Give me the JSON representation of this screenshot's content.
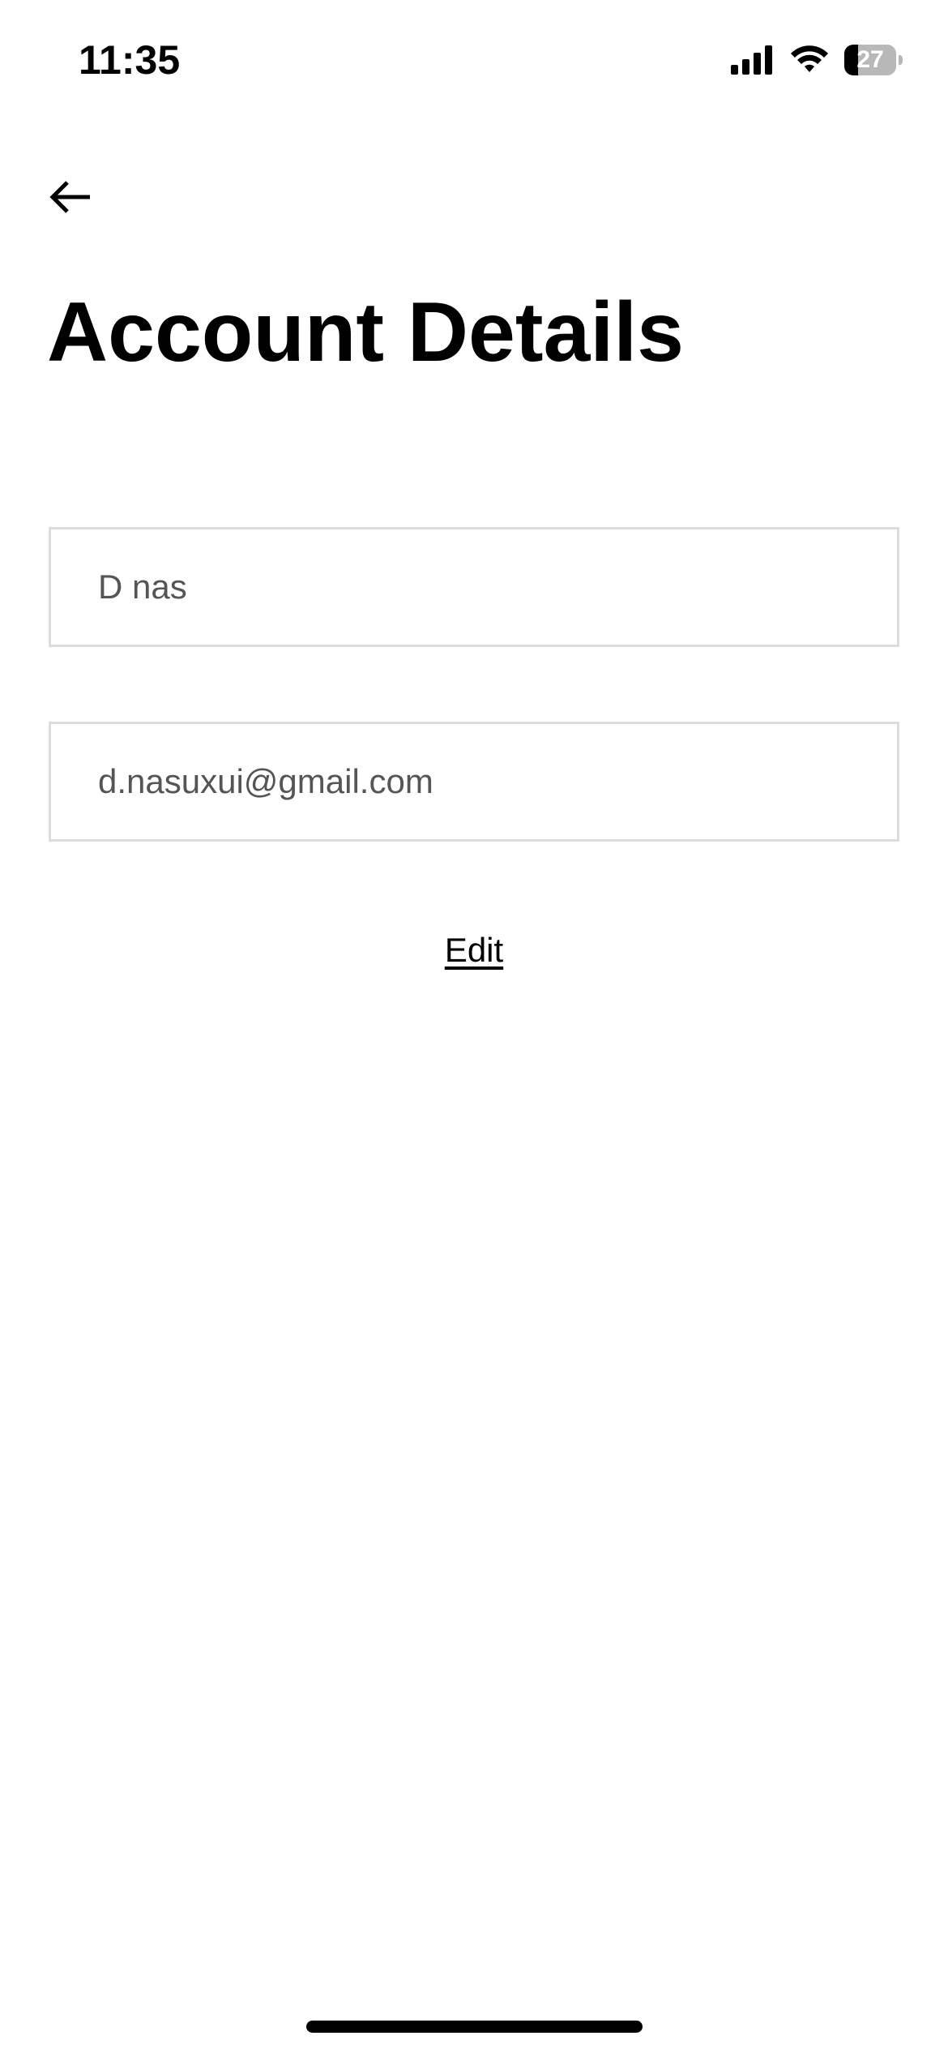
{
  "status_bar": {
    "time": "11:35",
    "battery_level": "27",
    "battery_fraction": 0.27,
    "icons": [
      "signal-icon",
      "wifi-icon",
      "battery-icon"
    ]
  },
  "header": {
    "back_icon": "arrow-left-icon",
    "title": "Account Details"
  },
  "form": {
    "name_value": "D nas",
    "email_value": "d.nasuxui@gmail.com"
  },
  "actions": {
    "edit_label": "Edit"
  },
  "colors": {
    "background": "#ffffff",
    "text": "#000000",
    "field_text": "#555555",
    "field_border": "#dcdcdc"
  }
}
